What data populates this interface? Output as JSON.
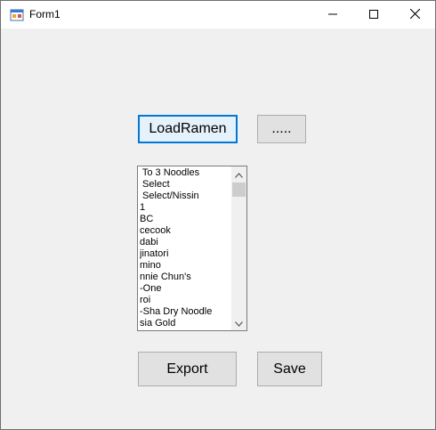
{
  "window": {
    "title": "Form1"
  },
  "buttons": {
    "load": "LoadRamen",
    "dots": ".....",
    "export": "Export",
    "save": "Save"
  },
  "listbox": {
    "items": [
      " To 3 Noodles",
      " Select",
      " Select/Nissin",
      "1",
      "BC",
      "cecook",
      "dabi",
      "jinatori",
      "mino",
      "nnie Chun's",
      "-One",
      "roi",
      "-Sha Dry Noodle",
      "sia Gold"
    ]
  },
  "colors": {
    "focus_border": "#0078d7",
    "button_face": "#e1e1e1",
    "client_background": "#f0f0f0"
  },
  "icons": {
    "app": "windows-form-icon",
    "minimize": "minimize-icon",
    "maximize": "maximize-icon",
    "close": "close-icon",
    "scroll_up": "scroll-up-arrow-icon",
    "scroll_down": "scroll-down-arrow-icon"
  }
}
